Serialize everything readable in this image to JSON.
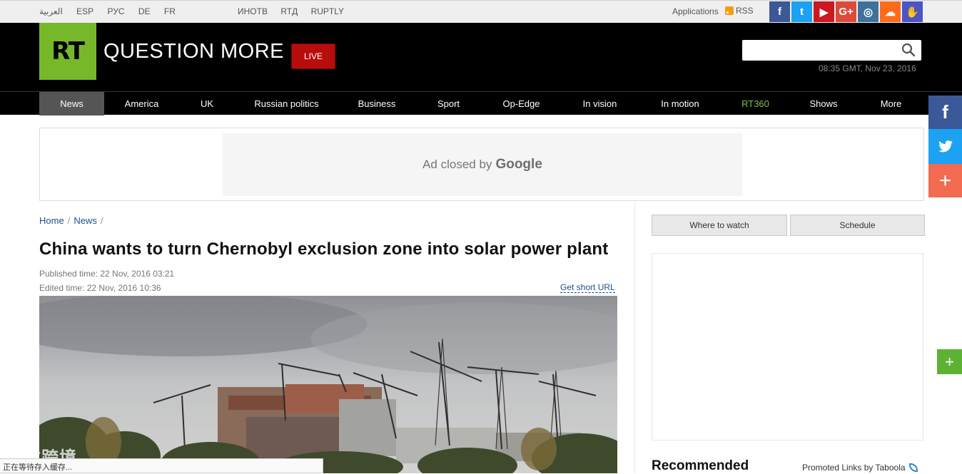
{
  "topbar": {
    "languages": [
      "العربية",
      "ESP",
      "РУС",
      "DE",
      "FR"
    ],
    "partners": [
      "ИНОТВ",
      "RTД",
      "RUPTLY"
    ],
    "applications": "Applications",
    "rss": "RSS",
    "socials": [
      {
        "name": "facebook",
        "glyph": "f",
        "color": "#3b5998"
      },
      {
        "name": "twitter",
        "glyph": "t",
        "color": "#1da1f2"
      },
      {
        "name": "youtube",
        "glyph": "▶",
        "color": "#cc181e"
      },
      {
        "name": "google-plus",
        "glyph": "G+",
        "color": "#dd4b39"
      },
      {
        "name": "instagram",
        "glyph": "◎",
        "color": "#3f729b"
      },
      {
        "name": "soundcloud",
        "glyph": "☁",
        "color": "#ff6b1a"
      },
      {
        "name": "rt-hand",
        "glyph": "✋",
        "color": "#4b56c4"
      }
    ]
  },
  "header": {
    "logo": "RT",
    "slogan": "QUESTION MORE",
    "live_label": "LIVE",
    "search_placeholder": "",
    "datetime": "08:35 GMT, Nov 23, 2016"
  },
  "nav": {
    "items": [
      {
        "label": "News",
        "active": true
      },
      {
        "label": "America"
      },
      {
        "label": "UK"
      },
      {
        "label": "Russian politics"
      },
      {
        "label": "Business"
      },
      {
        "label": "Sport"
      },
      {
        "label": "Op-Edge"
      },
      {
        "label": "In vision"
      },
      {
        "label": "In motion"
      },
      {
        "label": "RT360",
        "highlight": true
      },
      {
        "label": "Shows"
      },
      {
        "label": "More"
      }
    ]
  },
  "ad": {
    "text": "Ad closed by",
    "brand": "Google"
  },
  "article": {
    "breadcrumb": [
      "Home",
      "News"
    ],
    "breadcrumb_sep": "/",
    "title": "China wants to turn Chernobyl exclusion zone into solar power plant",
    "published": "Published time: 22 Nov, 2016 03:21",
    "edited": "Edited time: 22 Nov, 2016 10:36",
    "short_url": "Get short URL"
  },
  "sidebar": {
    "where_to_watch": "Where to watch",
    "schedule": "Schedule",
    "recommended": "Recommended",
    "promoted": "Promoted Links by Taboola"
  },
  "share": {
    "facebook": "f",
    "more": "+",
    "green_more": "+"
  },
  "status": {
    "text": "正在等待存入缓存...",
    "watermark": "大数跨境"
  }
}
